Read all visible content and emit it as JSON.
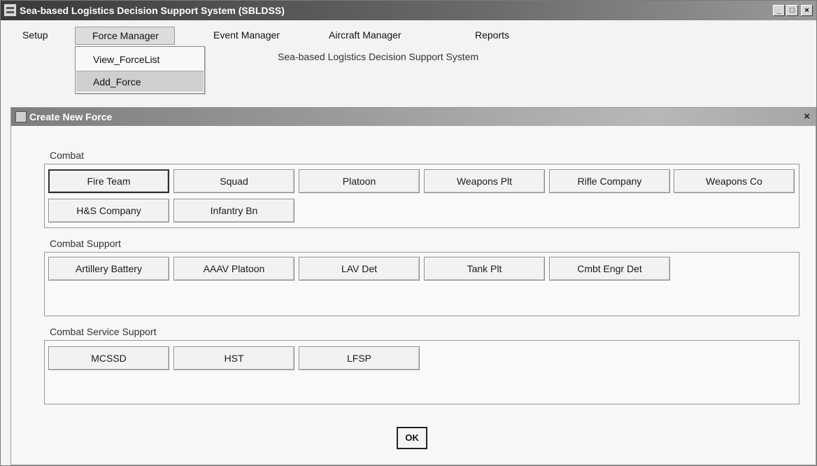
{
  "window": {
    "title": "Sea-based Logistics Decision Support System (SBLDSS)",
    "controls": {
      "minimize": "_",
      "maximize": "□",
      "close": "×"
    }
  },
  "menubar": {
    "items": [
      "Setup",
      "Force Manager",
      "Event Manager",
      "Aircraft Manager",
      "Reports"
    ],
    "active": "Force Manager",
    "dropdown": [
      "View_ForceList",
      "Add_Force"
    ],
    "dropdown_selected": "Add_Force"
  },
  "caption": "Sea-based Logistics Decision Support System",
  "dialog": {
    "title": "Create New Force",
    "close": "×",
    "groups": {
      "combat": {
        "label": "Combat",
        "buttons": [
          "Fire Team",
          "Squad",
          "Platoon",
          "Weapons Plt",
          "Rifle Company",
          "Weapons Co",
          "H&S Company",
          "Infantry Bn"
        ]
      },
      "support": {
        "label": "Combat Support",
        "buttons": [
          "Artillery Battery",
          "AAAV Platoon",
          "LAV Det",
          "Tank Plt",
          "Cmbt Engr Det"
        ]
      },
      "service": {
        "label": "Combat Service Support",
        "buttons": [
          "MCSSD",
          "HST",
          "LFSP"
        ]
      }
    },
    "ok": "OK"
  },
  "colors": {
    "titlebar": "#3a3a3a",
    "dialog_titlebar": "#9a9a9a",
    "background": "#f3f3f3"
  }
}
